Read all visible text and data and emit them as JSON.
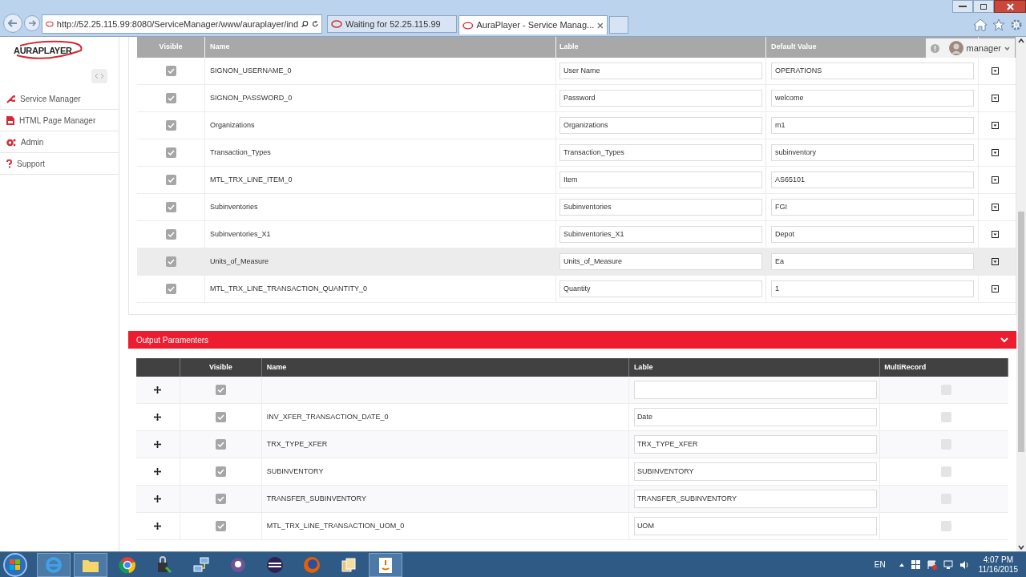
{
  "browser": {
    "address": "http://52.25.115.99:8080/ServiceManager/www/auraplayer/ind",
    "tabs": [
      {
        "title": "Waiting for 52.25.115.99",
        "selected": false
      },
      {
        "title": "AuraPlayer - Service Manag...",
        "selected": true
      }
    ]
  },
  "app": {
    "logo": "AURAPLAYER",
    "user": "manager"
  },
  "sidebar": {
    "items": [
      {
        "label": "Service Manager"
      },
      {
        "label": "HTML Page Manager"
      },
      {
        "label": "Admin"
      },
      {
        "label": "Support"
      }
    ]
  },
  "input_table": {
    "columns": [
      "Visible",
      "Name",
      "Lable",
      "Default Value"
    ],
    "rows": [
      {
        "visible": true,
        "name": "SIGNON_USERNAME_0",
        "label": "User Name",
        "default_value": "OPERATIONS",
        "selected": false
      },
      {
        "visible": true,
        "name": "SIGNON_PASSWORD_0",
        "label": "Password",
        "default_value": "welcome",
        "selected": false
      },
      {
        "visible": true,
        "name": "Organizations",
        "label": "Organizations",
        "default_value": "m1",
        "selected": false
      },
      {
        "visible": true,
        "name": "Transaction_Types",
        "label": "Transaction_Types",
        "default_value": "subinventory",
        "selected": false
      },
      {
        "visible": true,
        "name": "MTL_TRX_LINE_ITEM_0",
        "label": "Item",
        "default_value": "AS65101",
        "selected": false
      },
      {
        "visible": true,
        "name": "Subinventories",
        "label": "Subinventories",
        "default_value": "FGI",
        "selected": false
      },
      {
        "visible": true,
        "name": "Subinventories_X1",
        "label": "Subinventories_X1",
        "default_value": "Depot",
        "selected": false
      },
      {
        "visible": true,
        "name": "Units_of_Measure",
        "label": "Units_of_Measure",
        "default_value": "Ea",
        "selected": true
      },
      {
        "visible": true,
        "name": "MTL_TRX_LINE_TRANSACTION_QUANTITY_0",
        "label": "Quantity",
        "default_value": "1",
        "selected": false
      }
    ]
  },
  "output_section": {
    "title": "Output Paramenters",
    "expanded": true,
    "columns": [
      "Visible",
      "Name",
      "Lable",
      "MultiRecord"
    ],
    "rows": [
      {
        "visible": true,
        "name": "",
        "label": "",
        "multi_record": false
      },
      {
        "visible": true,
        "name": "INV_XFER_TRANSACTION_DATE_0",
        "label": "Date",
        "multi_record": false
      },
      {
        "visible": true,
        "name": "TRX_TYPE_XFER",
        "label": "TRX_TYPE_XFER",
        "multi_record": false
      },
      {
        "visible": true,
        "name": "SUBINVENTORY",
        "label": "SUBINVENTORY",
        "multi_record": false
      },
      {
        "visible": true,
        "name": "TRANSFER_SUBINVENTORY",
        "label": "TRANSFER_SUBINVENTORY",
        "multi_record": false
      },
      {
        "visible": true,
        "name": "MTL_TRX_LINE_TRANSACTION_UOM_0",
        "label": "UOM",
        "multi_record": false
      }
    ]
  },
  "taskbar": {
    "language": "EN",
    "time": "4:07 PM",
    "date": "11/16/2015"
  }
}
